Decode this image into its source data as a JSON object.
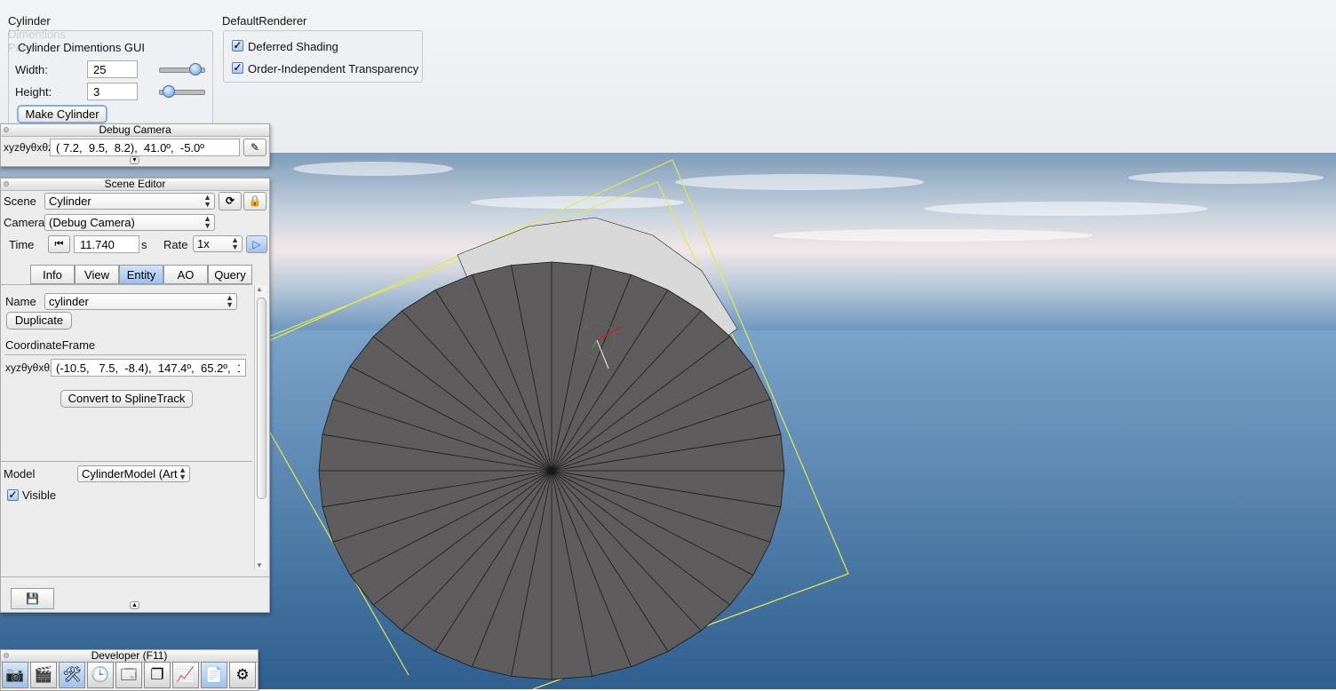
{
  "colors": {
    "accent": "#9cc2ee",
    "sky_top": "#f2f3f4",
    "ocean": "#3d6a96",
    "cylinder": "#5e5c5c",
    "bbox_line": "#e6e84a"
  },
  "cyl_pane": {
    "title": "Cylinder Dimentions Pane",
    "gui_title": "Cylinder Dimentions GUI",
    "width_label": "Width:",
    "width_value": "25",
    "width_level": 0.95,
    "height_label": "Height:",
    "height_value": "3",
    "height_level": 0.1,
    "make_button": "Make Cylinder"
  },
  "renderer": {
    "title": "DefaultRenderer",
    "deferred_label": "Deferred Shading",
    "deferred_checked": true,
    "oit_label": "Order-Independent Transparency",
    "oit_checked": true
  },
  "debug_camera": {
    "title": "Debug Camera",
    "xyz_label": "xyzθyθxθz",
    "value": "( 7.2,  9.5,  8.2),  41.0º,  -5.0º",
    "edit_icon": "pencil-icon",
    "expand_icon": "chevron-down-icon"
  },
  "scene_editor": {
    "title": "Scene Editor",
    "scene_label": "Scene",
    "scene_value": "Cylinder",
    "camera_label": "Camera",
    "camera_value": "(Debug Camera)",
    "time_label": "Time",
    "time_value": "11.740",
    "time_unit": "s",
    "rate_label": "Rate",
    "rate_value": "1x",
    "reload_icon": "reload-icon",
    "lock_icon": "lock-icon",
    "rewind_icon": "rewind-icon",
    "play_icon": "play-icon",
    "tabs": [
      {
        "label": "Info",
        "active": false
      },
      {
        "label": "View",
        "active": false
      },
      {
        "label": "Entity",
        "active": true
      },
      {
        "label": "AO",
        "active": false
      },
      {
        "label": "Query",
        "active": false
      }
    ],
    "entity": {
      "name_label": "Name",
      "name_value": "cylinder",
      "duplicate_button": "Duplicate",
      "frame_heading": "CoordinateFrame",
      "xyz_label": "xyzθyθxθz",
      "frame_value": "(-10.5,   7.5,  -8.4),  147.4º,  65.2º,  1",
      "convert_button": "Convert to SplineTrack",
      "model_label": "Model",
      "model_value": "CylinderModel (Art",
      "visible_label": "Visible",
      "visible_checked": true
    },
    "save_icon": "save-icon",
    "collapse_icon": "chevron-up-icon"
  },
  "developer": {
    "title": "Developer (F11)",
    "tools": [
      {
        "icon": "camera-icon",
        "glyph": "📷",
        "active": true
      },
      {
        "icon": "film-icon",
        "glyph": "🎬",
        "active": false
      },
      {
        "icon": "tools-icon",
        "glyph": "🛠",
        "active": true
      },
      {
        "icon": "clock-icon",
        "glyph": "🕒",
        "active": false
      },
      {
        "icon": "window-icon",
        "glyph": "🗔",
        "active": false
      },
      {
        "icon": "windows-icon",
        "glyph": "❐",
        "active": false
      },
      {
        "icon": "monitor-icon",
        "glyph": "📈",
        "active": false
      },
      {
        "icon": "document-icon",
        "glyph": "📄",
        "active": true
      },
      {
        "icon": "gear-icon",
        "glyph": "⚙",
        "active": false
      }
    ]
  }
}
